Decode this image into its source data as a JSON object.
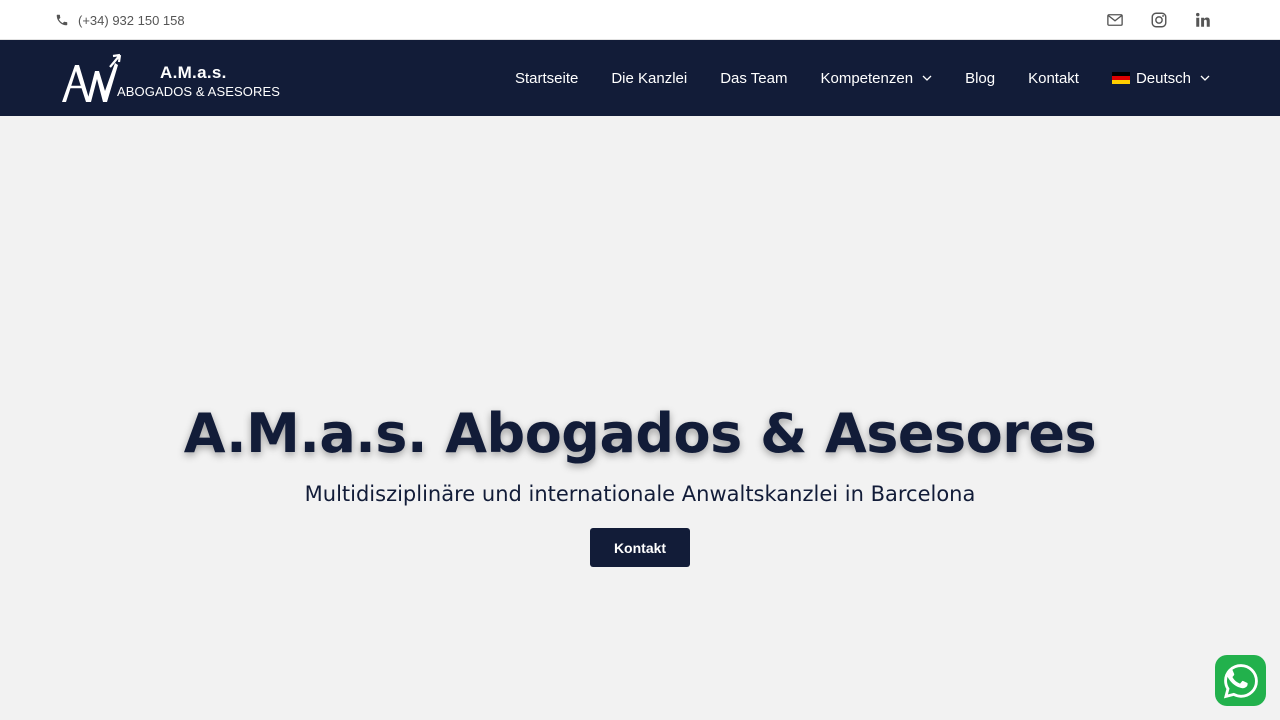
{
  "topbar": {
    "phone": "(+34) 932 150 158",
    "icons": [
      "phone-icon",
      "mail-icon",
      "instagram-icon",
      "linkedin-icon"
    ]
  },
  "logo": {
    "line1": "A.M.a.s.",
    "line2": "ABOGADOS & ASESORES"
  },
  "nav": {
    "items": [
      {
        "label": "Startseite"
      },
      {
        "label": "Die Kanzlei"
      },
      {
        "label": "Das Team"
      },
      {
        "label": "Kompetenzen"
      },
      {
        "label": "Blog"
      },
      {
        "label": "Kontakt"
      },
      {
        "label": "Deutsch"
      }
    ]
  },
  "hero": {
    "title": "A.M.a.s. Abogados & Asesores",
    "subtitle": "Multidisziplinäre und internationale Anwaltskanzlei in Barcelona",
    "cta": "Kontakt"
  },
  "colors": {
    "navy": "#121c38",
    "background": "#f2f2f2",
    "whatsapp": "#22b14c"
  }
}
